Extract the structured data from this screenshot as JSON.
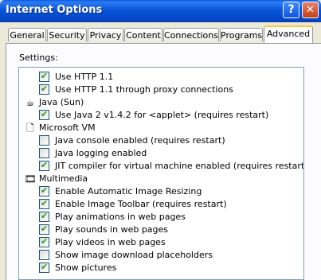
{
  "window": {
    "title": "Internet Options",
    "help_label": "?",
    "close_label": "✕"
  },
  "tabs": [
    {
      "label": "General"
    },
    {
      "label": "Security"
    },
    {
      "label": "Privacy"
    },
    {
      "label": "Content"
    },
    {
      "label": "Connections"
    },
    {
      "label": "Programs"
    },
    {
      "label": "Advanced"
    }
  ],
  "active_tab": "Advanced",
  "settings_label": "Settings:",
  "settings": [
    {
      "type": "checkbox",
      "checked": true,
      "label": "Use HTTP 1.1"
    },
    {
      "type": "checkbox",
      "checked": true,
      "label": "Use HTTP 1.1 through proxy connections"
    },
    {
      "type": "category",
      "icon": "java-coffee-icon",
      "label": "Java (Sun)"
    },
    {
      "type": "checkbox",
      "checked": true,
      "label": "Use Java 2 v1.4.2 for <applet> (requires restart)"
    },
    {
      "type": "category",
      "icon": "document-icon",
      "label": "Microsoft VM"
    },
    {
      "type": "checkbox",
      "checked": false,
      "label": "Java console enabled (requires restart)"
    },
    {
      "type": "checkbox",
      "checked": false,
      "label": "Java logging enabled"
    },
    {
      "type": "checkbox",
      "checked": true,
      "label": "JIT compiler for virtual machine enabled (requires restart)"
    },
    {
      "type": "category",
      "icon": "multimedia-icon",
      "label": "Multimedia"
    },
    {
      "type": "checkbox",
      "checked": true,
      "label": "Enable Automatic Image Resizing"
    },
    {
      "type": "checkbox",
      "checked": true,
      "label": "Enable Image Toolbar (requires restart)"
    },
    {
      "type": "checkbox",
      "checked": true,
      "label": "Play animations in web pages"
    },
    {
      "type": "checkbox",
      "checked": true,
      "label": "Play sounds in web pages"
    },
    {
      "type": "checkbox",
      "checked": true,
      "label": "Play videos in web pages"
    },
    {
      "type": "checkbox",
      "checked": false,
      "label": "Show image download placeholders"
    },
    {
      "type": "checkbox",
      "checked": true,
      "label": "Show pictures"
    }
  ],
  "scrollbar": {
    "up_icon": "▲",
    "down_icon": "▼"
  },
  "colors": {
    "titlebar": "#0a54d8",
    "check": "#21a121",
    "tab_highlight": "#ffc83c"
  }
}
